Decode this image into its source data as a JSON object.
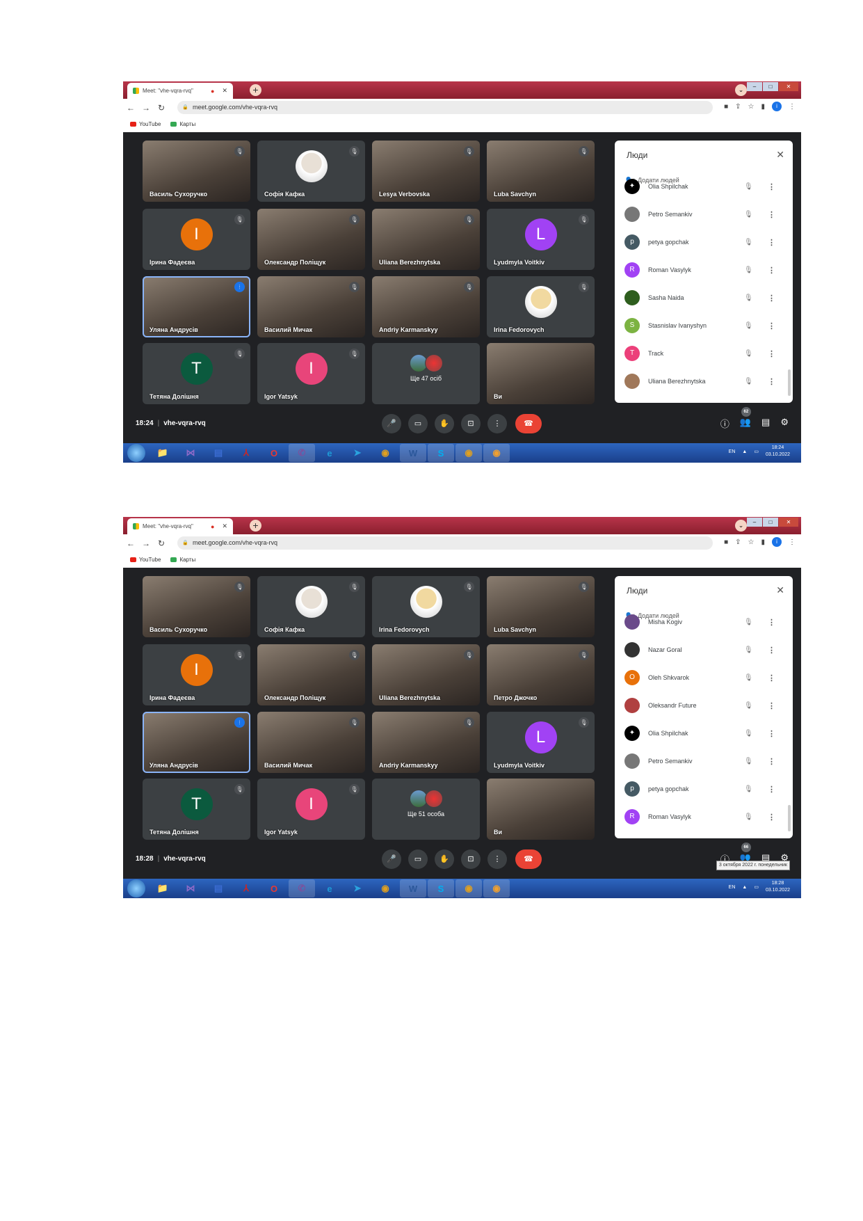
{
  "screenshots": [
    {
      "tab_title": "Meet: \"vhe-vqra-rvq\"",
      "url": "meet.google.com/vhe-vqra-rvq",
      "bookmarks": [
        "YouTube",
        "Карты"
      ],
      "tiles": [
        {
          "name": "Василь Сухоручко",
          "kind": "video"
        },
        {
          "name": "Софія Кафка",
          "kind": "photo",
          "color": "#e8e0d6"
        },
        {
          "name": "Lesya Verbovska",
          "kind": "video"
        },
        {
          "name": "Luba Savchyn",
          "kind": "video"
        },
        {
          "name": "Ірина Фадеєва",
          "kind": "avatar",
          "letter": "I",
          "color": "#e8710a"
        },
        {
          "name": "Олександр Поліщук",
          "kind": "video"
        },
        {
          "name": "Uliana Berezhnytska",
          "kind": "video"
        },
        {
          "name": "Lyudmyla Voitkiv",
          "kind": "avatar",
          "letter": "L",
          "color": "#a142f4"
        },
        {
          "name": "Уляна Андрусів",
          "kind": "video",
          "active": true
        },
        {
          "name": "Василий Мичак",
          "kind": "video"
        },
        {
          "name": "Andriy Karmanskyy",
          "kind": "video"
        },
        {
          "name": "Irina Fedorovych",
          "kind": "photo",
          "color": "#f1d9a0"
        },
        {
          "name": "Тетяна Долішня",
          "kind": "avatar",
          "letter": "T",
          "color": "#0b5a3e"
        },
        {
          "name": "Igor Yatsyk",
          "kind": "avatar",
          "letter": "I",
          "color": "#e8457a"
        },
        {
          "name": "",
          "kind": "more",
          "more": "Ще 47 осіб"
        },
        {
          "name": "Ви",
          "kind": "video"
        }
      ],
      "panel": {
        "title": "Люди",
        "add_people": "Додати людей",
        "people": [
          {
            "name": "Olia Shpilchak",
            "color": "#000000",
            "letter": "✦"
          },
          {
            "name": "Petro Semankiv",
            "color": "#777777",
            "letter": ""
          },
          {
            "name": "petya gopchak",
            "color": "#455a64",
            "letter": "p"
          },
          {
            "name": "Roman Vasylyk",
            "color": "#a142f4",
            "letter": "R"
          },
          {
            "name": "Sasha Naida",
            "color": "#2e5e1e",
            "letter": ""
          },
          {
            "name": "Stasnislav Ivanyshyn",
            "color": "#7cb342",
            "letter": "S"
          },
          {
            "name": "Track",
            "color": "#ec407a",
            "letter": "T"
          },
          {
            "name": "Uliana Berezhnytska",
            "color": "#a0785a",
            "letter": ""
          }
        ]
      },
      "time": "18:24",
      "meeting_code": "vhe-vqra-rvq",
      "participant_count": "62",
      "tooltip": "",
      "tray": {
        "lang": "EN",
        "clock_time": "18:24",
        "clock_date": "03.10.2022"
      }
    },
    {
      "tab_title": "Meet: \"vhe-vqra-rvq\"",
      "url": "meet.google.com/vhe-vqra-rvq",
      "bookmarks": [
        "YouTube",
        "Карты"
      ],
      "tiles": [
        {
          "name": "Василь Сухоручко",
          "kind": "video"
        },
        {
          "name": "Софія Кафка",
          "kind": "photo",
          "color": "#e8e0d6"
        },
        {
          "name": "Irina Fedorovych",
          "kind": "photo",
          "color": "#f1d9a0"
        },
        {
          "name": "Luba Savchyn",
          "kind": "video"
        },
        {
          "name": "Ірина Фадеєва",
          "kind": "avatar",
          "letter": "I",
          "color": "#e8710a"
        },
        {
          "name": "Олександр Поліщук",
          "kind": "video"
        },
        {
          "name": "Uliana Berezhnytska",
          "kind": "video"
        },
        {
          "name": "Петро Джочко",
          "kind": "video"
        },
        {
          "name": "Уляна Андрусів",
          "kind": "video",
          "active": true
        },
        {
          "name": "Василий Мичак",
          "kind": "video"
        },
        {
          "name": "Andriy Karmanskyy",
          "kind": "video"
        },
        {
          "name": "Lyudmyla Voitkiv",
          "kind": "avatar",
          "letter": "L",
          "color": "#a142f4"
        },
        {
          "name": "Тетяна Долішня",
          "kind": "avatar",
          "letter": "T",
          "color": "#0b5a3e"
        },
        {
          "name": "Igor Yatsyk",
          "kind": "avatar",
          "letter": "I",
          "color": "#e8457a"
        },
        {
          "name": "",
          "kind": "more",
          "more": "Ще 51 особа"
        },
        {
          "name": "Ви",
          "kind": "video"
        }
      ],
      "panel": {
        "title": "Люди",
        "add_people": "Додати людей",
        "people": [
          {
            "name": "Misha Kogiv",
            "color": "#6a4a8a",
            "letter": ""
          },
          {
            "name": "Nazar Goral",
            "color": "#333333",
            "letter": ""
          },
          {
            "name": "Oleh Shkvarok",
            "color": "#e8710a",
            "letter": "O"
          },
          {
            "name": "Oleksandr Future",
            "color": "#b04040",
            "letter": ""
          },
          {
            "name": "Olia Shpilchak",
            "color": "#000000",
            "letter": "✦"
          },
          {
            "name": "Petro Semankiv",
            "color": "#777777",
            "letter": ""
          },
          {
            "name": "petya gopchak",
            "color": "#455a64",
            "letter": "p"
          },
          {
            "name": "Roman Vasylyk",
            "color": "#a142f4",
            "letter": "R"
          }
        ]
      },
      "time": "18:28",
      "meeting_code": "vhe-vqra-rvq",
      "participant_count": "66",
      "tooltip": "3 октября 2022 г. понедельник",
      "tray": {
        "lang": "EN",
        "clock_time": "18:28",
        "clock_date": "03.10.2022"
      }
    }
  ],
  "icons": {
    "mic": "🎤",
    "cam": "▭",
    "hand": "✋",
    "present": "⊡",
    "more": "⋮",
    "end": "☎",
    "info": "ⓘ",
    "people": "👥",
    "chat": "▤",
    "activities": "⚙"
  },
  "taskbar_apps": [
    "start",
    "explorer",
    "visual-studio",
    "floppy",
    "acrobat",
    "opera",
    "viber",
    "edge",
    "telegram",
    "chrome",
    "word",
    "skype",
    "chrome",
    "chrome-canary"
  ]
}
